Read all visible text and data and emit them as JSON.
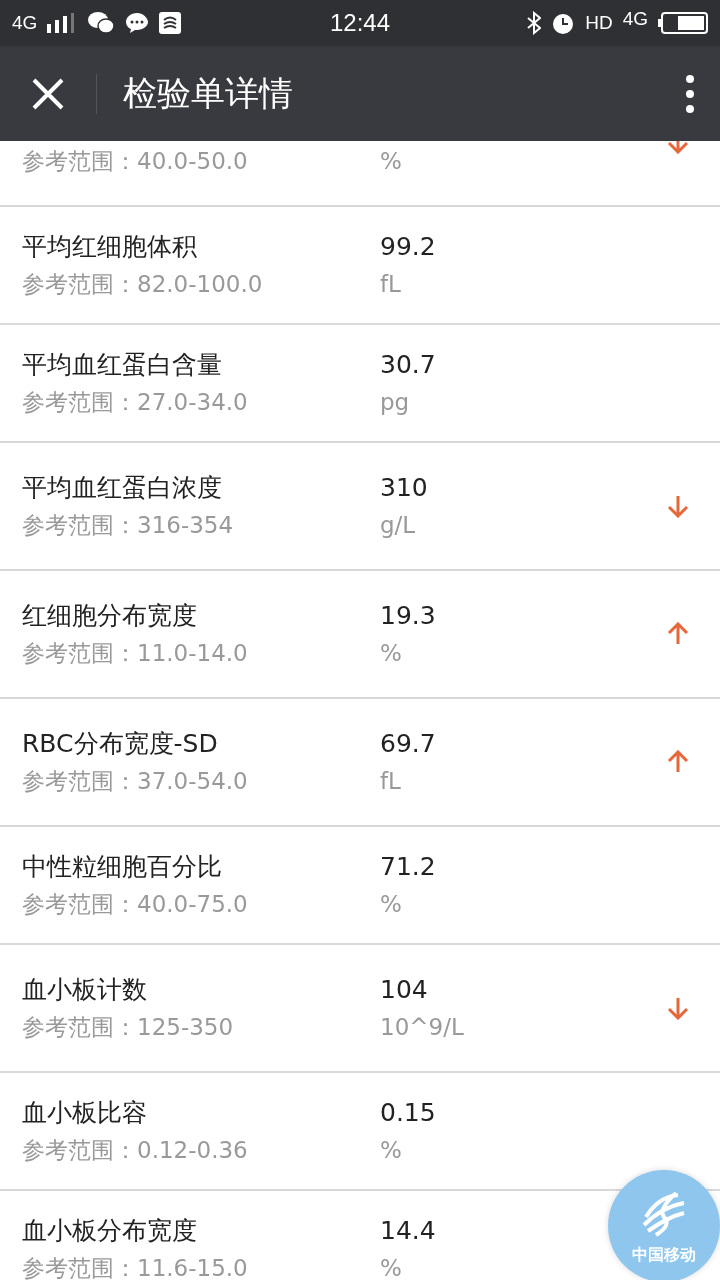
{
  "status_bar": {
    "network": "4G",
    "time": "12:44",
    "hd": "HD",
    "network_right": "4G"
  },
  "header": {
    "title": "检验单详情"
  },
  "results": [
    {
      "range": "参考范围：40.0-50.0",
      "unit": "%",
      "high": false,
      "low": true
    },
    {
      "name": "平均红细胞体积",
      "range": "参考范围：82.0-100.0",
      "value": "99.2",
      "unit": "fL",
      "high": false,
      "low": false
    },
    {
      "name": "平均血红蛋白含量",
      "range": "参考范围：27.0-34.0",
      "value": "30.7",
      "unit": "pg",
      "high": false,
      "low": false
    },
    {
      "name": "平均血红蛋白浓度",
      "range": "参考范围：316-354",
      "value": "310",
      "unit": "g/L",
      "high": false,
      "low": true
    },
    {
      "name": "红细胞分布宽度",
      "range": "参考范围：11.0-14.0",
      "value": "19.3",
      "unit": "%",
      "high": true,
      "low": false
    },
    {
      "name": "RBC分布宽度-SD",
      "range": "参考范围：37.0-54.0",
      "value": "69.7",
      "unit": "fL",
      "high": true,
      "low": false
    },
    {
      "name": "中性粒细胞百分比",
      "range": "参考范围：40.0-75.0",
      "value": "71.2",
      "unit": "%",
      "high": false,
      "low": false
    },
    {
      "name": "血小板计数",
      "range": "参考范围：125-350",
      "value": "104",
      "unit": "10^9/L",
      "high": false,
      "low": true
    },
    {
      "name": "血小板比容",
      "range": "参考范围：0.12-0.36",
      "value": "0.15",
      "unit": "%",
      "high": false,
      "low": false
    },
    {
      "name": "血小板分布宽度",
      "range": "参考范围：11.6-15.0",
      "value": "14.4",
      "unit": "%",
      "high": false,
      "low": false
    }
  ],
  "floating_ball": {
    "label": "中国移动"
  }
}
